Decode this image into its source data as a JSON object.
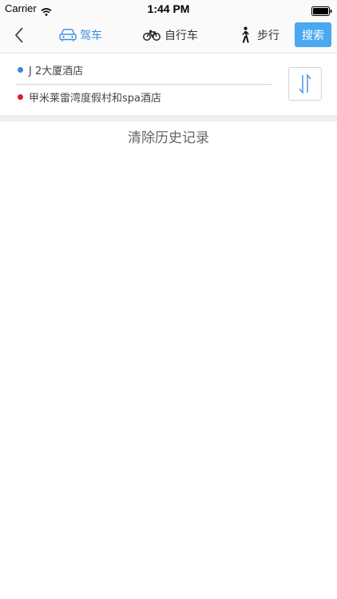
{
  "status_bar": {
    "carrier": "Carrier",
    "time": "1:44 PM"
  },
  "nav": {
    "modes": [
      {
        "label": "驾车",
        "icon": "car-icon",
        "active": true
      },
      {
        "label": "自行车",
        "icon": "bicycle-icon",
        "active": false
      },
      {
        "label": "步行",
        "icon": "walking-icon",
        "active": false
      }
    ],
    "search_label": "搜索",
    "accent_color": "#3a8fe3",
    "search_button_color": "#4aa8f0"
  },
  "route": {
    "start": "J 2大厦酒店",
    "end": "甲米莱雷湾度假村和spa酒店",
    "start_dot_color": "#3d84e3",
    "end_dot_color": "#e3172f"
  },
  "clear_history_label": "清除历史记录"
}
